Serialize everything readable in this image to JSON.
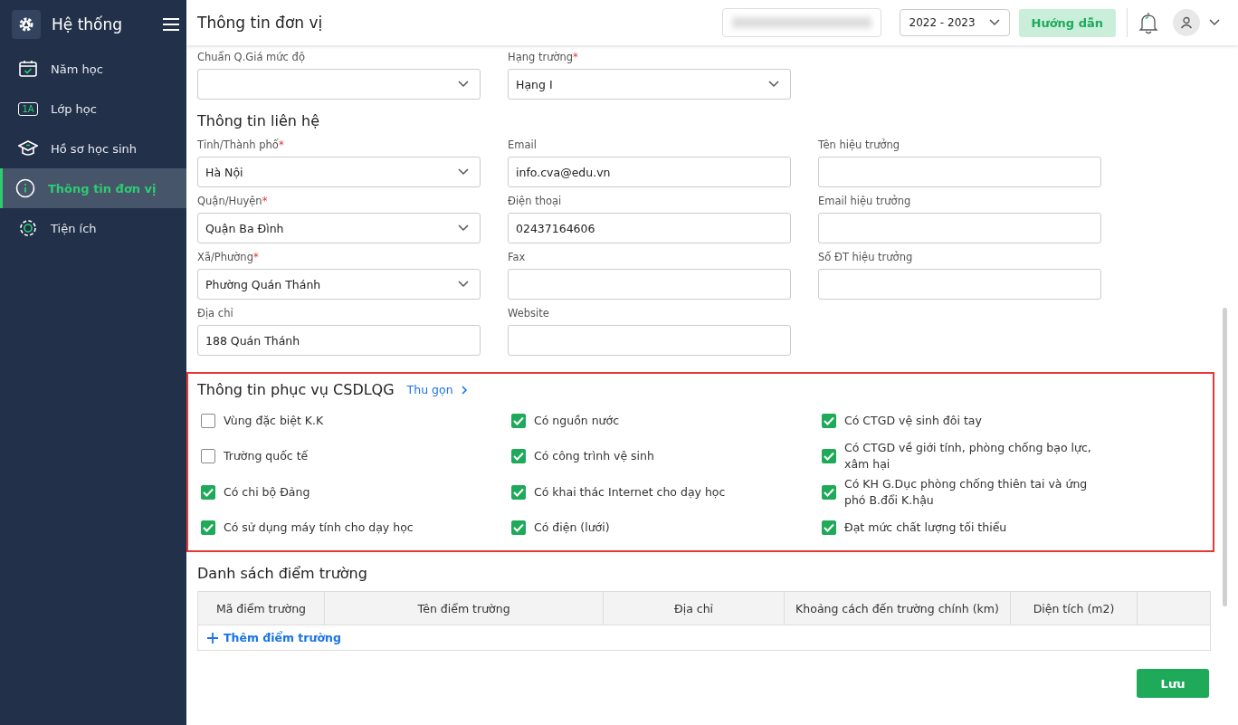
{
  "sidebar": {
    "title": "Hệ thống",
    "items": [
      {
        "label": "Năm học",
        "selected": false
      },
      {
        "label": "Lớp học",
        "badge": "1A",
        "selected": false
      },
      {
        "label": "Hồ sơ học sinh",
        "selected": false
      },
      {
        "label": "Thông tin đơn vị",
        "selected": true
      },
      {
        "label": "Tiện ích",
        "selected": false
      }
    ]
  },
  "header": {
    "title": "Thông tin đơn vị",
    "school_year": "2022 - 2023",
    "guide_button": "Hướng dẫn"
  },
  "top_fields": [
    {
      "label": "Chuẩn Q.Giá mức độ",
      "kind": "select"
    },
    {
      "label": "Hạng trường",
      "required_mark": "*",
      "kind": "select",
      "value": "Hạng I"
    }
  ],
  "contact": {
    "title": "Thông tin liên hệ",
    "fields": [
      {
        "label": "Tỉnh/Thành phố",
        "required_mark": "*",
        "kind": "select",
        "value": "Hà Nội"
      },
      {
        "label": "Email",
        "kind": "input",
        "value": "info.cva@edu.vn"
      },
      {
        "label": "Tên hiệu trưởng",
        "kind": "input"
      },
      {
        "label": "Quận/Huyện",
        "required_mark": "*",
        "kind": "select",
        "value": "Quận Ba Đình"
      },
      {
        "label": "Điện thoại",
        "kind": "input",
        "value": "02437164606"
      },
      {
        "label": "Email hiệu trưởng",
        "kind": "input"
      },
      {
        "label": "Xã/Phường",
        "required_mark": "*",
        "kind": "select",
        "value": "Phường Quán Thánh"
      },
      {
        "label": "Fax",
        "kind": "input"
      },
      {
        "label": "Số ĐT hiệu trưởng",
        "kind": "input"
      },
      {
        "label": "Địa chỉ",
        "kind": "input",
        "value": "188 Quán Thánh"
      },
      {
        "label": "Website",
        "kind": "input"
      }
    ]
  },
  "csdl": {
    "title": "Thông tin phục vụ CSDLQG",
    "collapse_link": "Thu gọn",
    "options": [
      {
        "label": "Vùng đặc biệt K.K",
        "checked": false
      },
      {
        "label": "Có nguồn nước",
        "checked": true
      },
      {
        "label": "Có CTGD vệ sinh đôi tay",
        "checked": true
      },
      {
        "label": "Trường quốc tế",
        "checked": false
      },
      {
        "label": "Có công trình vệ sinh",
        "checked": true
      },
      {
        "label": "Có CTGD về giới tính, phòng chống bạo lực, xâm hại",
        "checked": true
      },
      {
        "label": "Có chi bộ Đảng",
        "checked": true
      },
      {
        "label": "Có khai thác Internet cho dạy học",
        "checked": true
      },
      {
        "label": "Có KH G.Dục phòng chống thiên tai và ứng phó B.đổi K.hậu",
        "checked": true
      },
      {
        "label": "Có sử dụng máy tính cho dạy học",
        "checked": true
      },
      {
        "label": "Có điện (lưới)",
        "checked": true
      },
      {
        "label": "Đạt mức chất lượng tối thiểu",
        "checked": true
      }
    ]
  },
  "sites": {
    "title": "Danh sách điểm trường",
    "columns": [
      "Mã điểm trường",
      "Tên điểm trường",
      "Địa chỉ",
      "Khoảng cách đến trường chính (km)",
      "Diện tích (m2)"
    ],
    "add_link": "Thêm điểm trường"
  },
  "save_button": "Lưu"
}
